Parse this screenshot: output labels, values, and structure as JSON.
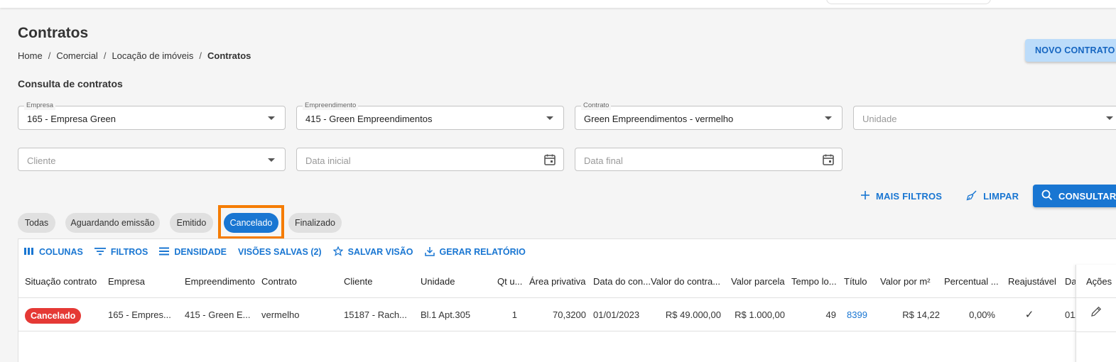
{
  "page": {
    "title": "Contratos",
    "breadcrumb": [
      "Home",
      "Comercial",
      "Locação de imóveis",
      "Contratos"
    ],
    "new_button": "NOVO CONTRATO",
    "section_title": "Consulta de contratos"
  },
  "filters": {
    "empresa": {
      "label": "Empresa",
      "value": "165 - Empresa Green"
    },
    "empreendimento": {
      "label": "Empreendimento",
      "value": "415 - Green Empreendimentos"
    },
    "contrato": {
      "label": "Contrato",
      "value": "Green Empreendimentos - vermelho"
    },
    "unidade": {
      "placeholder": "Unidade"
    },
    "cliente": {
      "placeholder": "Cliente"
    },
    "data_inicial": {
      "placeholder": "Data inicial"
    },
    "data_final": {
      "placeholder": "Data final"
    }
  },
  "actions": {
    "mais_filtros": "MAIS FILTROS",
    "limpar": "LIMPAR",
    "consultar": "CONSULTAR"
  },
  "chips": [
    {
      "label": "Todas",
      "active": false
    },
    {
      "label": "Aguardando emissão",
      "active": false
    },
    {
      "label": "Emitido",
      "active": false
    },
    {
      "label": "Cancelado",
      "active": true
    },
    {
      "label": "Finalizado",
      "active": false
    }
  ],
  "toolbar": {
    "colunas": "COLUNAS",
    "filtros": "FILTROS",
    "densidade": "DENSIDADE",
    "visoes_salvas": "VISÕES SALVAS (2)",
    "salvar_visao": "SALVAR VISÃO",
    "gerar_relatorio": "GERAR RELATÓRIO"
  },
  "table": {
    "columns": [
      "Situação contrato",
      "Empresa",
      "Empreendimento",
      "Contrato",
      "Cliente",
      "Unidade",
      "Qt u...",
      "Área privativa",
      "Data do con...",
      "Valor do contra...",
      "Valor parcela",
      "Tempo lo...",
      "Título",
      "Valor por m²",
      "Percentual ...",
      "Reajustável",
      "Da"
    ],
    "actions_header": "Ações",
    "rows": [
      {
        "situacao": "Cancelado",
        "empresa": "165 - Empres...",
        "empreendimento": "415 - Green E...",
        "contrato": "vermelho",
        "cliente": "15187 - Rach...",
        "unidade": "Bl.1 Apt.305",
        "qt": "1",
        "area": "70,3200",
        "data": "01/01/2023",
        "valor_contrato": "R$ 49.000,00",
        "valor_parcela": "R$ 1.000,00",
        "tempo": "49",
        "titulo": "8399",
        "valor_m2": "R$ 14,22",
        "percentual": "0,00%",
        "reajustavel": "✓",
        "da": "01/"
      }
    ]
  },
  "colors": {
    "primary": "#1976d2",
    "badge_red": "#e53935",
    "highlight_orange": "#f57c00"
  }
}
